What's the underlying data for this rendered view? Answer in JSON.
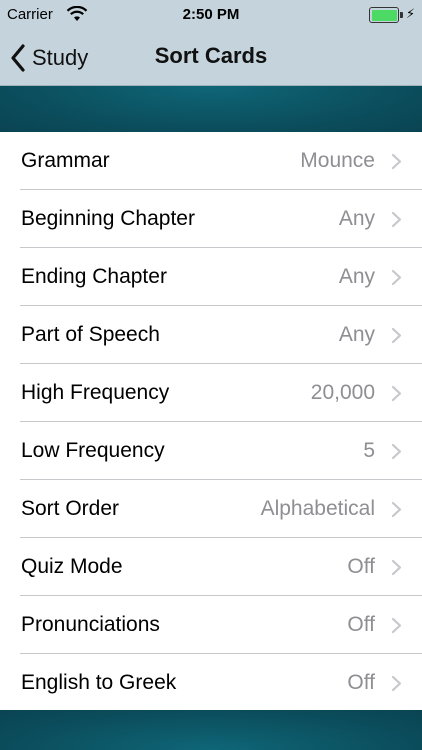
{
  "status_bar": {
    "carrier": "Carrier",
    "time": "2:50 PM"
  },
  "nav": {
    "back_label": "Study",
    "title": "Sort Cards"
  },
  "settings": [
    {
      "label": "Grammar",
      "value": "Mounce"
    },
    {
      "label": "Beginning Chapter",
      "value": "Any"
    },
    {
      "label": "Ending Chapter",
      "value": "Any"
    },
    {
      "label": "Part of Speech",
      "value": "Any"
    },
    {
      "label": "High Frequency",
      "value": "20,000"
    },
    {
      "label": "Low Frequency",
      "value": "5"
    },
    {
      "label": "Sort Order",
      "value": "Alphabetical"
    },
    {
      "label": "Quiz Mode",
      "value": "Off"
    },
    {
      "label": "Pronunciations",
      "value": "Off"
    },
    {
      "label": "English to Greek",
      "value": "Off"
    }
  ],
  "colors": {
    "nav_background": "#c5d4dc",
    "accent_teal": "#0b4c5b",
    "battery": "#4cd964",
    "value_gray": "#8e8e93"
  },
  "icons": [
    "wifi-icon",
    "battery-icon",
    "charging-bolt-icon",
    "back-chevron-icon",
    "disclosure-chevron-icon"
  ]
}
